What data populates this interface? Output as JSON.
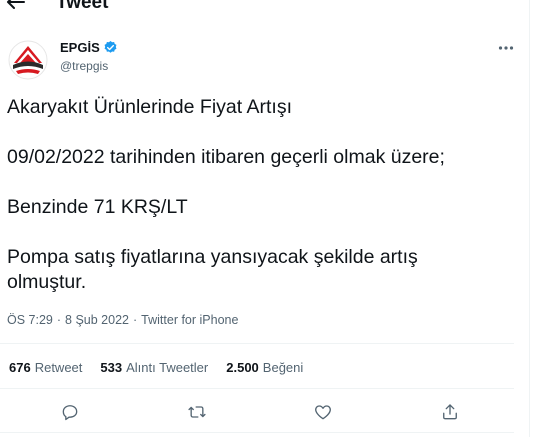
{
  "header": {
    "title": "Tweet",
    "back_icon": "arrow-left-icon"
  },
  "author": {
    "display_name": "EPGİS",
    "handle": "@trepgis",
    "verified_icon": "verified-badge-icon",
    "verified_color": "#1d9bf0",
    "avatar_colors": {
      "red": "#d71920",
      "dark": "#2b2b2b"
    }
  },
  "tweet": {
    "lines": [
      "Akaryakıt Ürünlerinde Fiyat Artışı",
      "09/02/2022 tarihinden itibaren geçerli olmak üzere;",
      "Benzinde 71 KRŞ/LT",
      "Pompa satış fiyatlarına yansıyacak şekilde artış olmuştur."
    ],
    "time": "ÖS 7:29",
    "date": "8 Şub 2022",
    "source": "Twitter for iPhone"
  },
  "stats": {
    "retweets_count": "676",
    "retweets_label": "Retweet",
    "quotes_count": "533",
    "quotes_label": "Alıntı Tweetler",
    "likes_count": "2.500",
    "likes_label": "Beğeni"
  },
  "actions": [
    "reply-icon",
    "retweet-icon",
    "like-icon",
    "share-icon"
  ],
  "colors": {
    "text": "#0f1419",
    "muted": "#536471",
    "border": "#eff3f4"
  }
}
